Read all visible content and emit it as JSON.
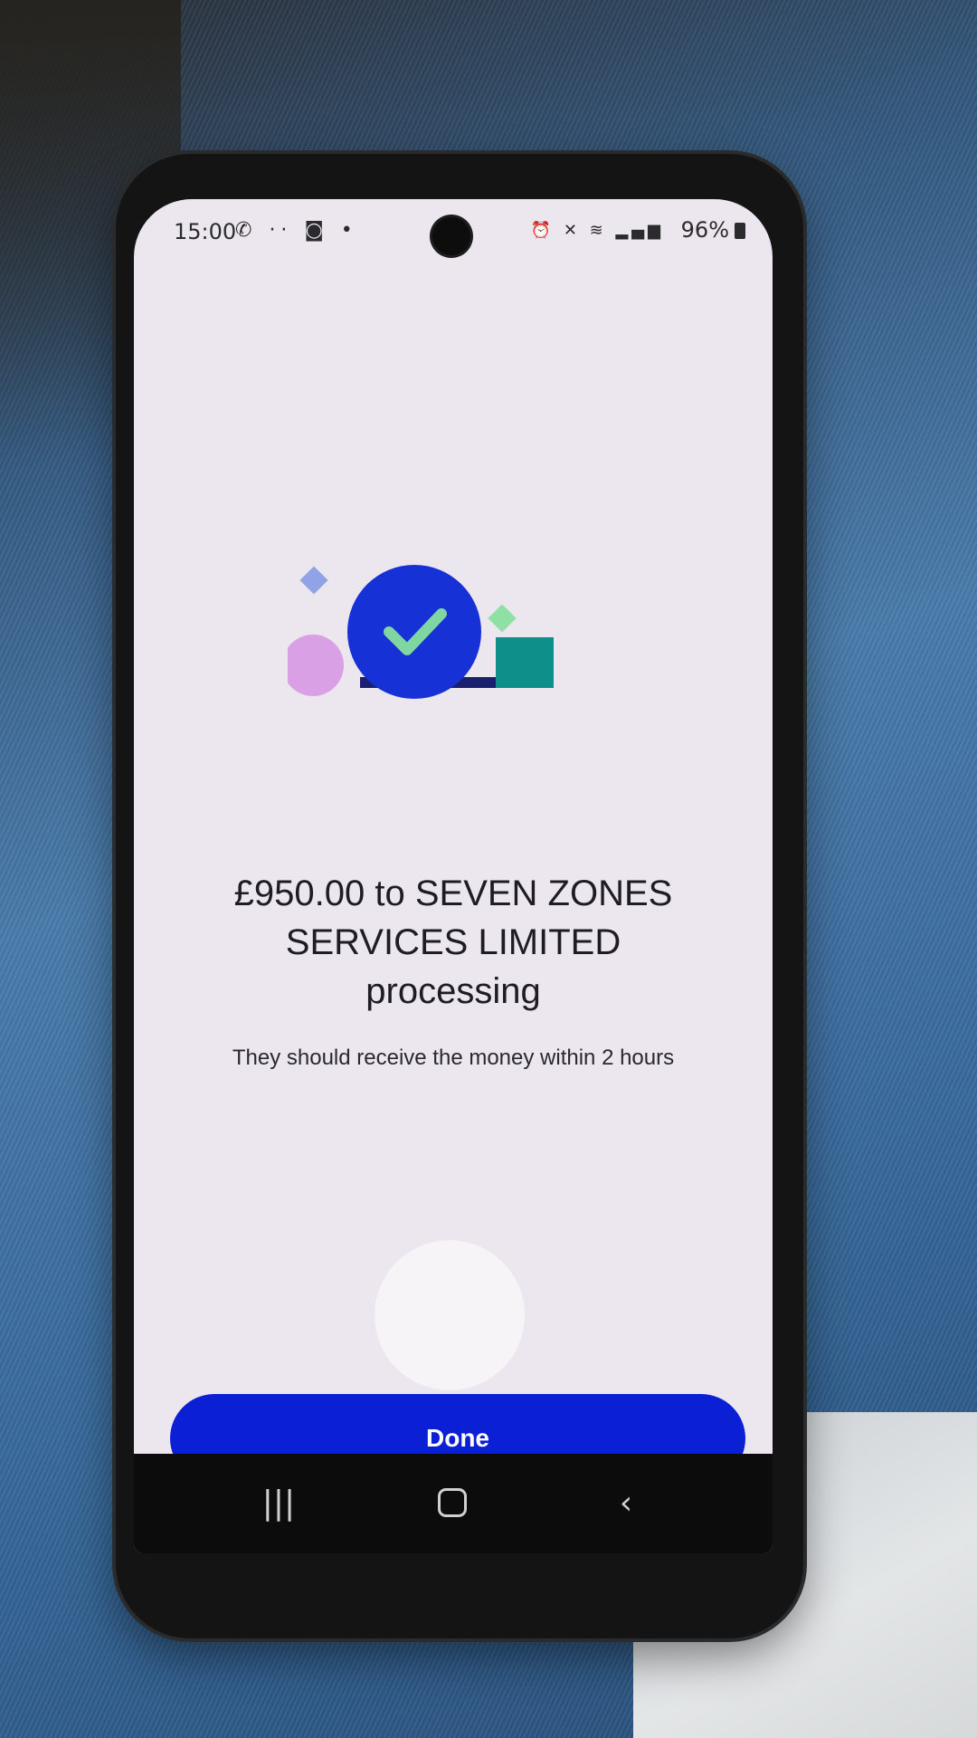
{
  "status_bar": {
    "time": "15:00",
    "left_icons": [
      "whatsapp-icon",
      "notification-dots-icon",
      "screenshot-icon",
      "dot-icon"
    ],
    "right_icons": [
      "alarm-icon",
      "mute-icon",
      "wifi-icon",
      "volte-icon",
      "signal-icon"
    ],
    "battery": "96%"
  },
  "confirmation": {
    "title_line1": "£950.00 to SEVEN ZONES",
    "title_line2": "SERVICES LIMITED",
    "title_line3": "processing",
    "subtitle": "They should receive the money within 2 hours"
  },
  "actions": {
    "done_label": "Done"
  },
  "colors": {
    "accent": "#0b1fd4",
    "check_circle": "#1631d6",
    "check_mark": "#7fd6a0",
    "teal_square": "#0e8f8a",
    "pink_circle": "#d9a0e6",
    "blue_diamond": "#8fa3e6",
    "green_diamond": "#8fe0a4",
    "screen_bg": "#ece6ee"
  },
  "nav_bar": {
    "items": [
      "recent-apps",
      "home",
      "back"
    ]
  }
}
